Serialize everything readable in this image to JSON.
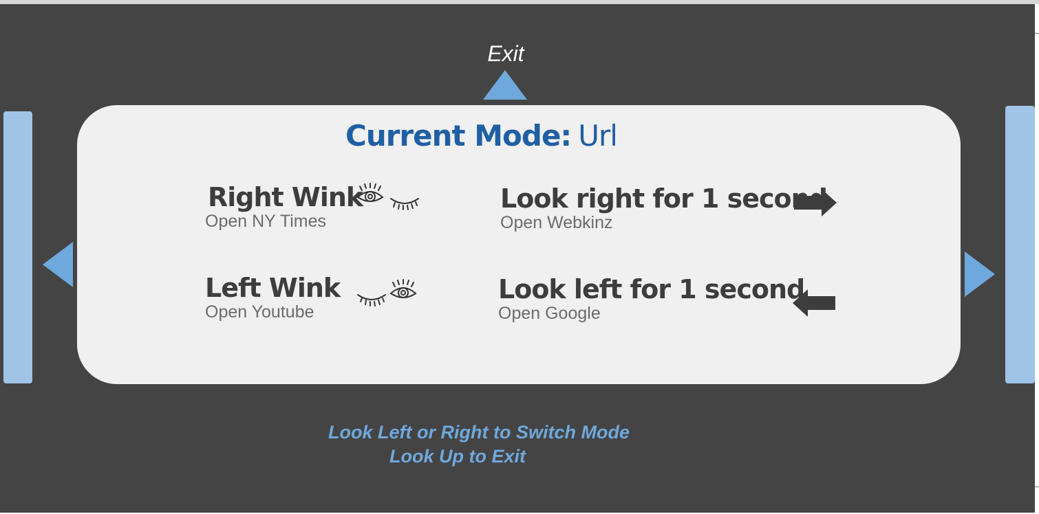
{
  "exit": {
    "label": "Exit",
    "arrow_icon": "up-arrow-icon"
  },
  "navigation": {
    "left_arrow_icon": "left-arrow-icon",
    "right_arrow_icon": "right-arrow-icon"
  },
  "panel": {
    "mode_label": "Current Mode:",
    "mode_value": "Url",
    "gestures": [
      {
        "title": "Right Wink",
        "action": "Open NY Times",
        "icon": "right-wink-eyes-icon"
      },
      {
        "title": "Left Wink",
        "action": "Open Youtube",
        "icon": "left-wink-eyes-icon"
      },
      {
        "title": "Look right for 1 second",
        "action": "Open Webkinz",
        "icon": "right-arrow-icon"
      },
      {
        "title": "Look left for 1 second",
        "action": "Open Google",
        "icon": "left-arrow-icon"
      }
    ]
  },
  "hints": {
    "line1": "Look Left or Right to Switch Mode",
    "line2": "Look Up to Exit"
  },
  "colors": {
    "background": "#444444",
    "panel": "#f0f0f0",
    "accent_blue": "#6fa8dc",
    "side_bar_blue": "#9fc4e6",
    "title_blue": "#1f5fa3",
    "gesture_text": "#3d3d3d"
  }
}
